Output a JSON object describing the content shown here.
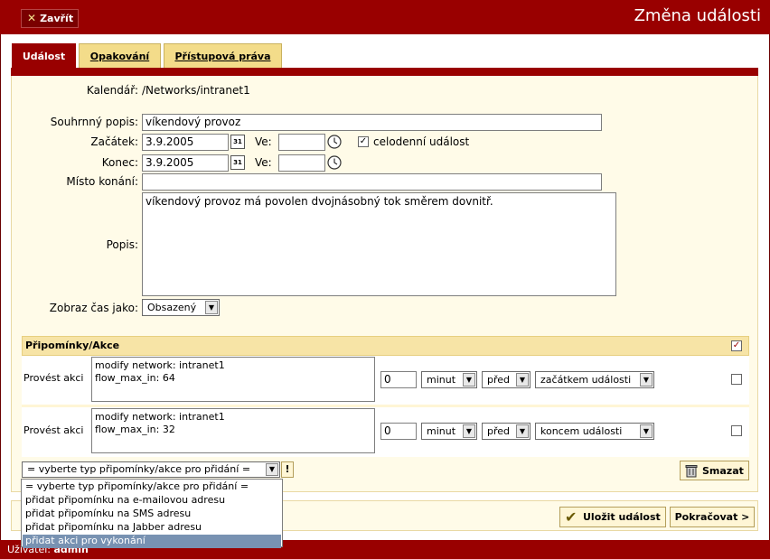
{
  "header": {
    "close_label": "Zavřít",
    "title": "Změna události"
  },
  "tabs": [
    {
      "label": "Událost",
      "active": true
    },
    {
      "label": "Opakování",
      "active": false
    },
    {
      "label": "Přístupová práva",
      "active": false
    }
  ],
  "form": {
    "calendar_label": "Kalendář:",
    "calendar_value": "/Networks/intranet1",
    "summary_label": "Souhrnný popis:",
    "summary_value": "víkendový provoz",
    "start_label": "Začátek:",
    "start_date": "3.9.2005",
    "start_time_label": "Ve:",
    "start_time": "",
    "all_day_label": "celodenní událost",
    "all_day_checked": true,
    "end_label": "Konec:",
    "end_date": "3.9.2005",
    "end_time_label": "Ve:",
    "end_time": "",
    "location_label": "Místo konání:",
    "location_value": "",
    "description_label": "Popis:",
    "description_value": "víkendový provoz má povolen dvojnásobný tok směrem dovnitř.",
    "show_time_label": "Zobraz čas jako:",
    "show_time_value": "Obsazený",
    "calendar_icon_text": "31"
  },
  "reminders": {
    "title": "Připomínky/Akce",
    "header_checked": true,
    "rows": [
      {
        "label": "Provést akci",
        "action": "modify network: intranet1\nflow_max_in: 64",
        "amount": "0",
        "unit": "minut",
        "relation": "před",
        "anchor": "začátkem události",
        "checked": false
      },
      {
        "label": "Provést akci",
        "action": "modify network: intranet1\nflow_max_in: 32",
        "amount": "0",
        "unit": "minut",
        "relation": "před",
        "anchor": "koncem události",
        "checked": false
      }
    ],
    "add_type_value": "= vyberte typ připomínky/akce pro přidání =",
    "add_button_label": "!",
    "delete_label": "Smazat",
    "add_options": [
      "= vyberte typ připomínky/akce pro přidání =",
      "přidat připomínku na e-mailovou adresu",
      "přidat připomínku na SMS adresu",
      "přidat připomínku na Jabber adresu",
      "přidat akci pro vykonání"
    ],
    "add_selected_index": 4
  },
  "actions": {
    "save_label": "Uložit událost",
    "continue_label": "Pokračovat >"
  },
  "footer": {
    "user_label": "Uživatel:",
    "user_name": "admin"
  },
  "colors": {
    "brand": "#990000",
    "panel": "#fffbe8",
    "tab_inactive": "#f3dc8a",
    "selection": "#7892b2"
  }
}
